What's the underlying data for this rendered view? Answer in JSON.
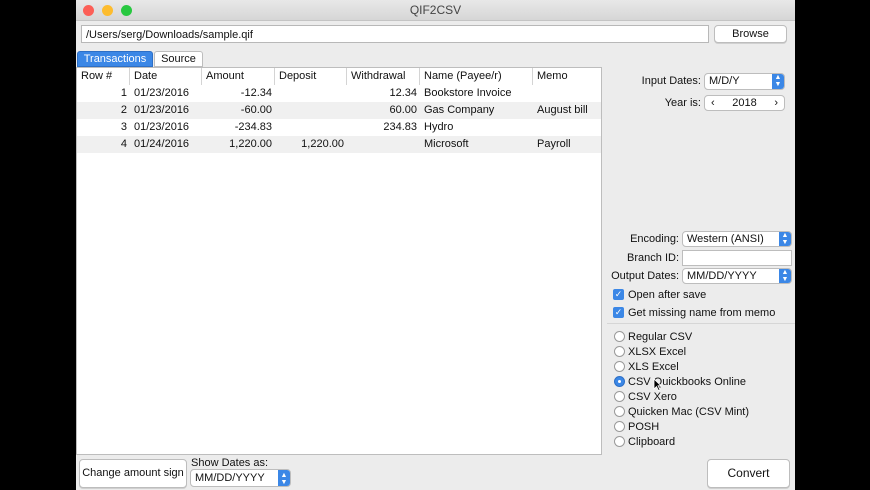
{
  "window": {
    "title": "QIF2CSV"
  },
  "path": {
    "value": "/Users/serg/Downloads/sample.qif"
  },
  "browse_label": "Browse",
  "tabs": [
    {
      "label": "Transactions"
    },
    {
      "label": "Source"
    }
  ],
  "table": {
    "columns": [
      "Row #",
      "Date",
      "Amount",
      "Deposit",
      "Withdrawal",
      "Name (Payee/r)",
      "Memo"
    ],
    "rows": [
      {
        "row": "1",
        "date": "01/23/2016",
        "amount": "-12.34",
        "deposit": "",
        "withdrawal": "12.34",
        "name": "Bookstore Invoice",
        "memo": ""
      },
      {
        "row": "2",
        "date": "01/23/2016",
        "amount": "-60.00",
        "deposit": "",
        "withdrawal": "60.00",
        "name": "Gas Company",
        "memo": "August bill"
      },
      {
        "row": "3",
        "date": "01/23/2016",
        "amount": "-234.83",
        "deposit": "",
        "withdrawal": "234.83",
        "name": "Hydro",
        "memo": ""
      },
      {
        "row": "4",
        "date": "01/24/2016",
        "amount": "1,220.00",
        "deposit": "1,220.00",
        "withdrawal": "",
        "name": "Microsoft",
        "memo": "Payroll"
      }
    ]
  },
  "side": {
    "input_dates_label": "Input Dates:",
    "input_dates_value": "M/D/Y",
    "year_label": "Year is:",
    "year_value": "2018",
    "encoding_label": "Encoding:",
    "encoding_value": "Western (ANSI)",
    "branch_label": "Branch ID:",
    "branch_value": "",
    "output_dates_label": "Output Dates:",
    "output_dates_value": "MM/DD/YYYY",
    "open_after_save": "Open after save",
    "get_missing_name": "Get missing name from memo"
  },
  "formats": [
    {
      "label": "Regular CSV",
      "selected": false
    },
    {
      "label": "XLSX Excel",
      "selected": false
    },
    {
      "label": "XLS Excel",
      "selected": false
    },
    {
      "label": "CSV Quickbooks Online",
      "selected": true
    },
    {
      "label": "CSV Xero",
      "selected": false
    },
    {
      "label": "Quicken Mac (CSV Mint)",
      "selected": false
    },
    {
      "label": "POSH",
      "selected": false
    },
    {
      "label": "Clipboard",
      "selected": false
    }
  ],
  "bottom": {
    "change_sign": "Change amount sign",
    "show_dates_label": "Show Dates as:",
    "show_dates_value": "MM/DD/YYYY",
    "convert": "Convert"
  },
  "colors": {
    "accent": "#3b87e6",
    "close": "#fc5f57",
    "minimize": "#fdbc2e",
    "zoom": "#28c840"
  }
}
